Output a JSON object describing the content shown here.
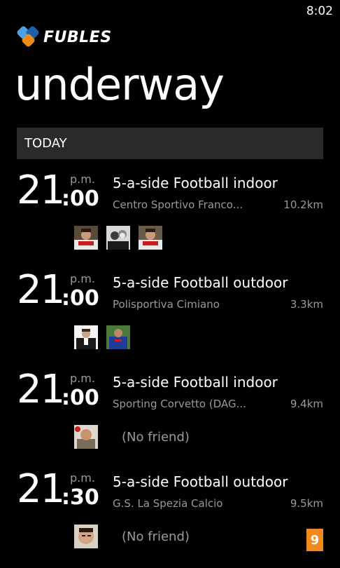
{
  "status_bar": {
    "time": "8:02"
  },
  "app": {
    "logo_text": "FUBLES",
    "logo_colors": [
      "#4aa3e8",
      "#1f5fa8",
      "#f08a1a"
    ]
  },
  "page": {
    "title": "underway"
  },
  "section": {
    "label": "TODAY"
  },
  "events": [
    {
      "hour": "21",
      "minute": ":00",
      "ampm": "p.m.",
      "title": "5-a-side Football indoor",
      "venue": "Centro Sportivo Franco...",
      "distance": "10.2km",
      "friends": [
        "friend-photo-1",
        "friend-photo-2",
        "friend-photo-3"
      ],
      "no_friend_text": ""
    },
    {
      "hour": "21",
      "minute": ":00",
      "ampm": "p.m.",
      "title": "5-a-side Football outdoor",
      "venue": "Polisportiva Cimiano",
      "distance": "3.3km",
      "friends": [
        "friend-photo-4",
        "friend-photo-5"
      ],
      "no_friend_text": ""
    },
    {
      "hour": "21",
      "minute": ":00",
      "ampm": "p.m.",
      "title": "5-a-side Football indoor",
      "venue": "Sporting Corvetto (DAG...",
      "distance": "9.4km",
      "friends": [
        "friend-photo-6"
      ],
      "no_friend_text": "(No friend)"
    },
    {
      "hour": "21",
      "minute": ":30",
      "ampm": "p.m.",
      "title": "5-a-side Football outdoor",
      "venue": "G.S. La Spezia Calcio",
      "distance": "9.5km",
      "friends": [
        "friend-photo-7"
      ],
      "no_friend_text": "(No friend)"
    }
  ],
  "badge": {
    "count": "9",
    "color": "#f08a1a"
  }
}
